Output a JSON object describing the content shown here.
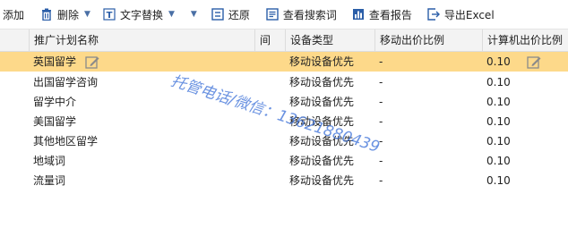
{
  "toolbar": {
    "add_label": "添加",
    "delete_label": "删除",
    "replace_label": "文字替换",
    "restore_label": "还原",
    "search_terms_label": "查看搜索词",
    "report_label": "查看报告",
    "export_label": "导出Excel"
  },
  "columns": [
    "推广计划名称",
    "间",
    "设备类型",
    "移动出价比例",
    "计算机出价比例"
  ],
  "rows": [
    {
      "name": "英国留学",
      "device": "移动设备优先",
      "mobile_ratio": "-",
      "pc_ratio": "0.10",
      "selected": true
    },
    {
      "name": "出国留学咨询",
      "device": "移动设备优先",
      "mobile_ratio": "-",
      "pc_ratio": "0.10",
      "selected": false
    },
    {
      "name": "留学中介",
      "device": "移动设备优先",
      "mobile_ratio": "-",
      "pc_ratio": "0.10",
      "selected": false
    },
    {
      "name": "美国留学",
      "device": "移动设备优先",
      "mobile_ratio": "-",
      "pc_ratio": "0.10",
      "selected": false
    },
    {
      "name": "其他地区留学",
      "device": "移动设备优先",
      "mobile_ratio": "-",
      "pc_ratio": "0.10",
      "selected": false
    },
    {
      "name": "地域词",
      "device": "移动设备优先",
      "mobile_ratio": "-",
      "pc_ratio": "0.10",
      "selected": false
    },
    {
      "name": "流量词",
      "device": "移动设备优先",
      "mobile_ratio": "-",
      "pc_ratio": "0.10",
      "selected": false
    }
  ],
  "watermark": "托管电话/微信：13621880439",
  "colors": {
    "selected_row": "#fdd98a",
    "icon_blue": "#2b5ea8",
    "watermark": "#3a6fd8"
  }
}
